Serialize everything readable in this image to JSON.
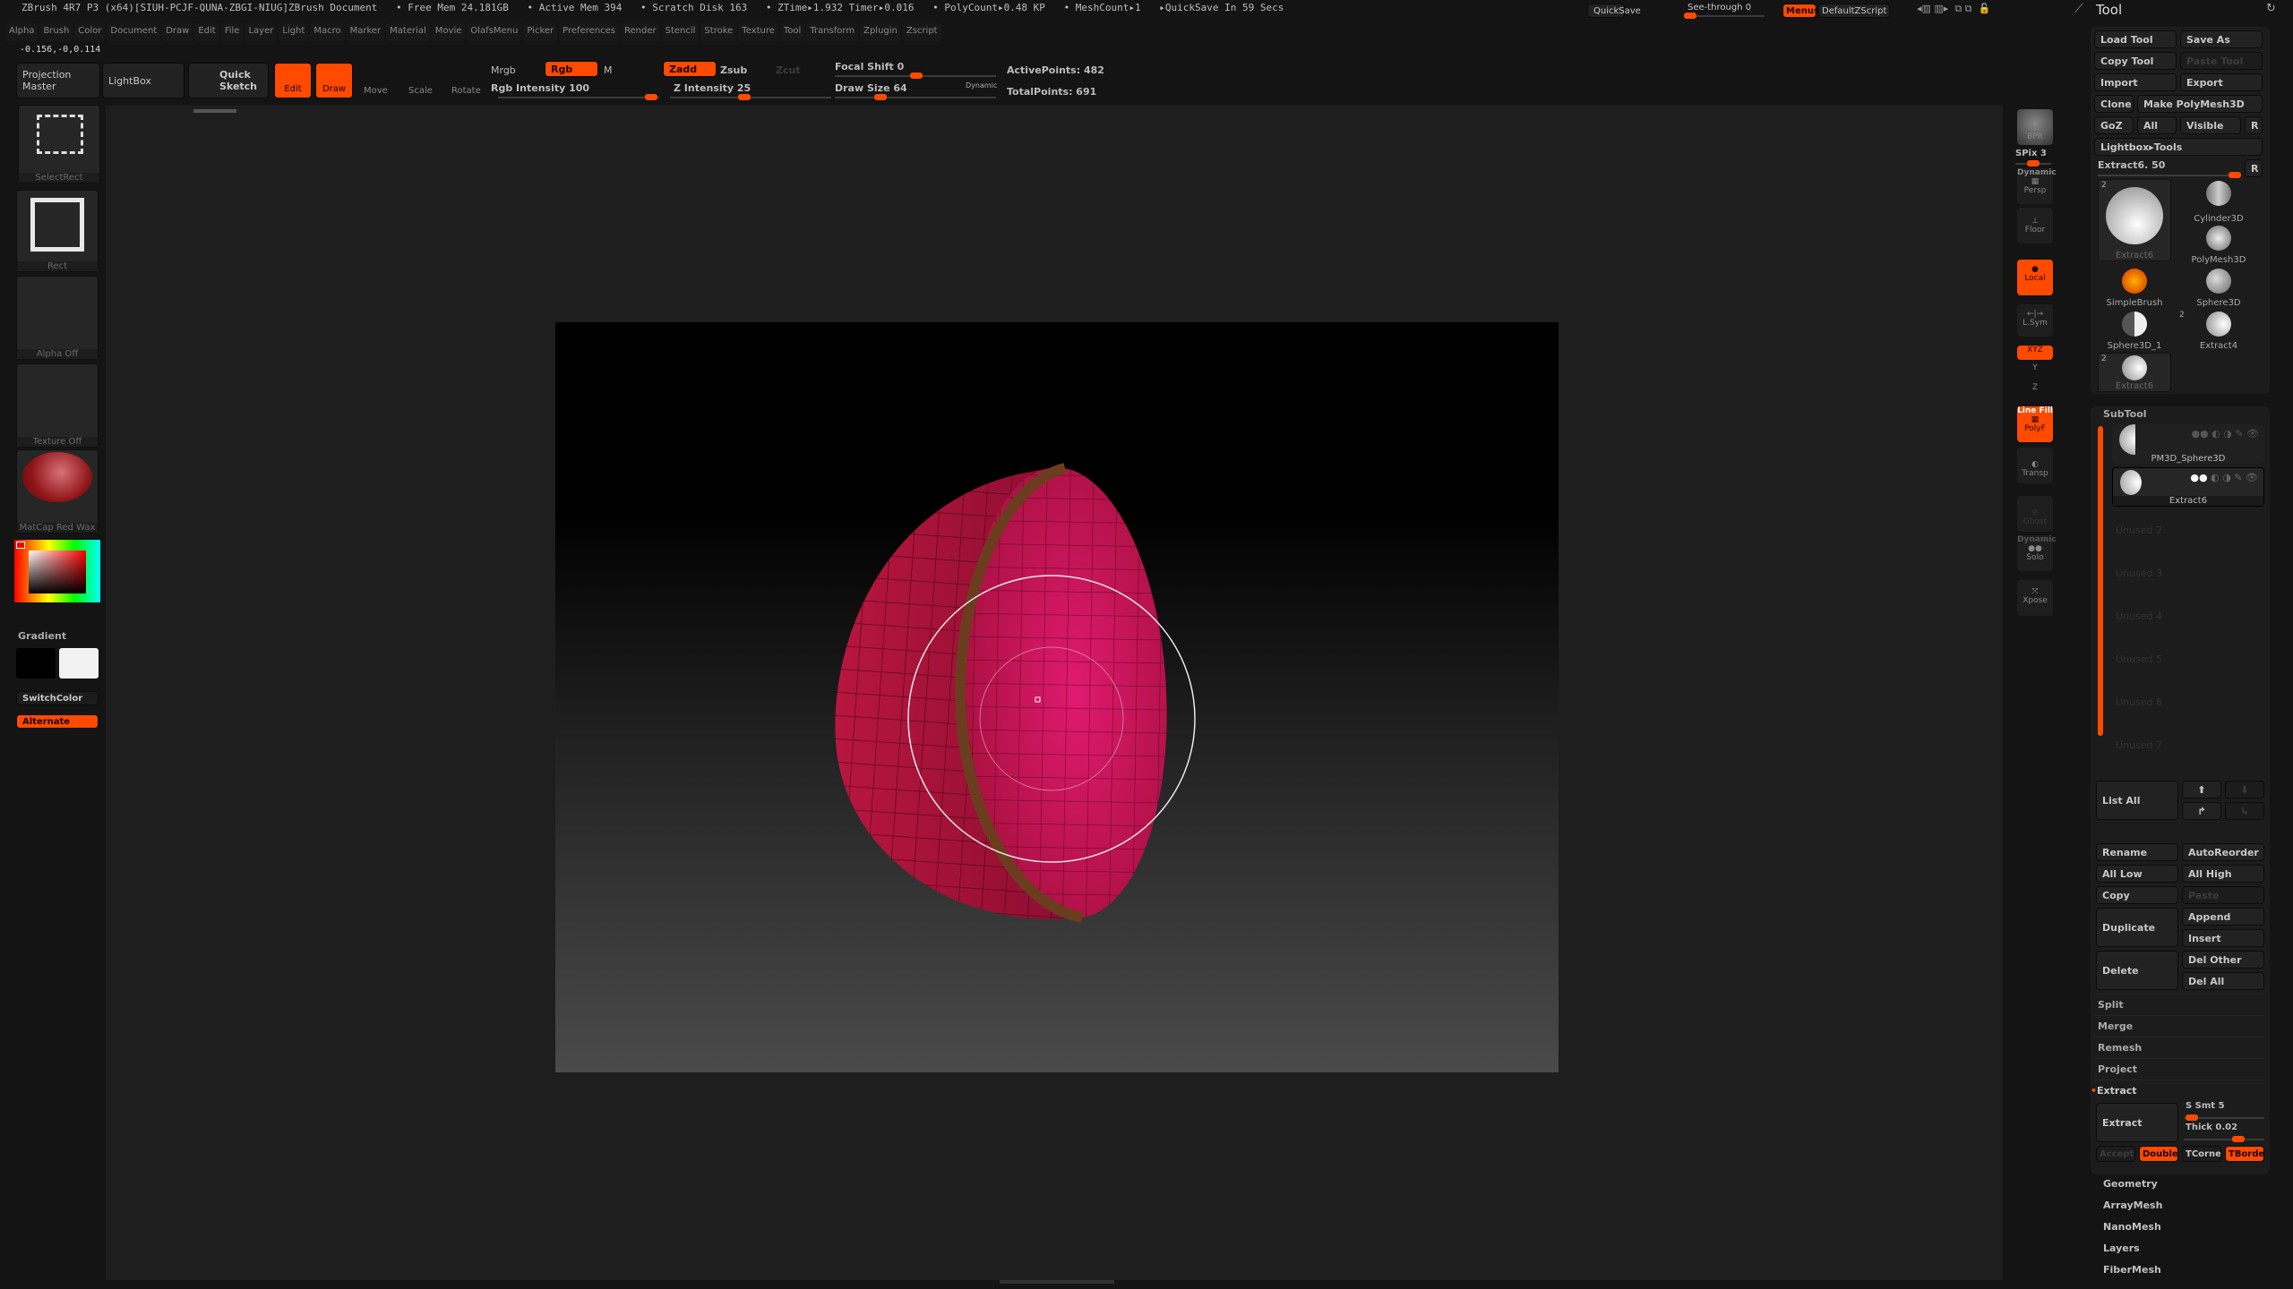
{
  "titlebar": {
    "app": "ZBrush 4R7 P3 (x64)[SIUH-PCJF-QUNA-ZBGI-NIUG]ZBrush Document",
    "free_mem": "• Free Mem 24.181GB",
    "active_mem": "• Active Mem 394",
    "scratch": "• Scratch Disk 163",
    "ztime": "• ZTime▸1.932 Timer▸0.016",
    "polycount": "• PolyCount▸0.48 KP",
    "meshcount": "• MeshCount▸1",
    "quicksave_in": "▸QuickSave In 59 Secs"
  },
  "topright": {
    "quicksave": "QuickSave",
    "see_through": "See-through",
    "see_through_value": "0",
    "menus": "Menus",
    "script": "DefaultZScript"
  },
  "menus": [
    "Alpha",
    "Brush",
    "Color",
    "Document",
    "Draw",
    "Edit",
    "File",
    "Layer",
    "Light",
    "Macro",
    "Marker",
    "Material",
    "Movie",
    "OlafsMenu",
    "Picker",
    "Preferences",
    "Render",
    "Stencil",
    "Stroke",
    "Texture",
    "Tool",
    "Transform",
    "Zplugin",
    "Zscript"
  ],
  "coords": "-0.156,-0,0.114",
  "toolbar": {
    "projection_master": "Projection Master",
    "lightbox": "LightBox",
    "quick_sketch": "Quick Sketch",
    "edit": "Edit",
    "draw": "Draw",
    "move": "Move",
    "scale": "Scale",
    "rotate": "Rotate",
    "mrgb": "Mrgb",
    "rgb": "Rgb",
    "m": "M",
    "zadd": "Zadd",
    "zsub": "Zsub",
    "zcut": "Zcut",
    "rgb_intensity": "Rgb Intensity 100",
    "rgb_intensity_value": 100,
    "z_intensity": "Z Intensity 25",
    "z_intensity_value": 25,
    "focal_shift": "Focal Shift 0",
    "draw_size": "Draw Size 64",
    "dynamic": "Dynamic",
    "active_points": "ActivePoints: 482",
    "total_points": "TotalPoints: 691"
  },
  "left_shelf": {
    "stroke": "SelectRect",
    "brush": "Rect",
    "alpha": "Alpha Off",
    "texture": "Texture Off",
    "material": "MatCap Red Wax",
    "gradient": "Gradient",
    "switch_color": "SwitchColor",
    "alternate": "Alternate",
    "main_color": "#ff0000"
  },
  "right_shelf": {
    "bpr": "BPR",
    "spix": "SPix 3",
    "persp_dyn": "Dynamic",
    "persp": "Persp",
    "floor": "Floor",
    "local": "Local",
    "lsym": "L.Sym",
    "xyz": "XYZ",
    "y": "Y",
    "z": "Z",
    "linefill": "Line Fill",
    "polyf": "PolyF",
    "transp": "Transp",
    "ghost": "Ghost",
    "solo_dyn": "Dynamic",
    "solo": "Solo",
    "xpose": "Xpose"
  },
  "tool": {
    "title": "Tool",
    "load": "Load Tool",
    "save_as": "Save As",
    "copy": "Copy Tool",
    "paste": "Paste Tool",
    "import": "Import",
    "export": "Export",
    "clone": "Clone",
    "make_polymesh": "Make PolyMesh3D",
    "goz": "GoZ",
    "all": "All",
    "visible": "Visible",
    "r": "R",
    "lightbox_tools": "Lightbox▸Tools",
    "current": "Extract6. 50",
    "thumbs": [
      {
        "label": "Extract6",
        "count": "2"
      },
      {
        "label": "Cylinder3D"
      },
      {
        "label": "PolyMesh3D"
      },
      {
        "label": "SimpleBrush"
      },
      {
        "label": "Sphere3D"
      },
      {
        "label": "Sphere3D_1"
      },
      {
        "label": "Extract4",
        "count": "2"
      },
      {
        "label": "Extract6",
        "count": "2"
      }
    ]
  },
  "subtool": {
    "title": "SubTool",
    "items": [
      "PM3D_Sphere3D",
      "Extract6"
    ],
    "unused": [
      "Unused 2",
      "Unused 3",
      "Unused 4",
      "Unused 5",
      "Unused 6",
      "Unused 7"
    ],
    "list_all": "List All",
    "rename": "Rename",
    "autoreorder": "AutoReorder",
    "all_low": "All Low",
    "all_high": "All High",
    "copy": "Copy",
    "paste": "Paste",
    "duplicate": "Duplicate",
    "append": "Append",
    "insert": "Insert",
    "delete": "Delete",
    "del_other": "Del Other",
    "del_all": "Del All",
    "split": "Split",
    "merge": "Merge",
    "remesh": "Remesh",
    "project": "Project",
    "extract_section": "Extract",
    "extract_btn": "Extract",
    "s_smt": "S Smt 5",
    "thick": "Thick 0.02",
    "accept": "Accept",
    "double": "Double",
    "tcorner": "TCorner",
    "tborder": "TBorde"
  },
  "folders": [
    "Geometry",
    "ArrayMesh",
    "NanoMesh",
    "Layers",
    "FiberMesh"
  ],
  "colors": {
    "accent": "#ff4a00",
    "mesh": "#c2134f",
    "rim": "#6b3d1f"
  }
}
